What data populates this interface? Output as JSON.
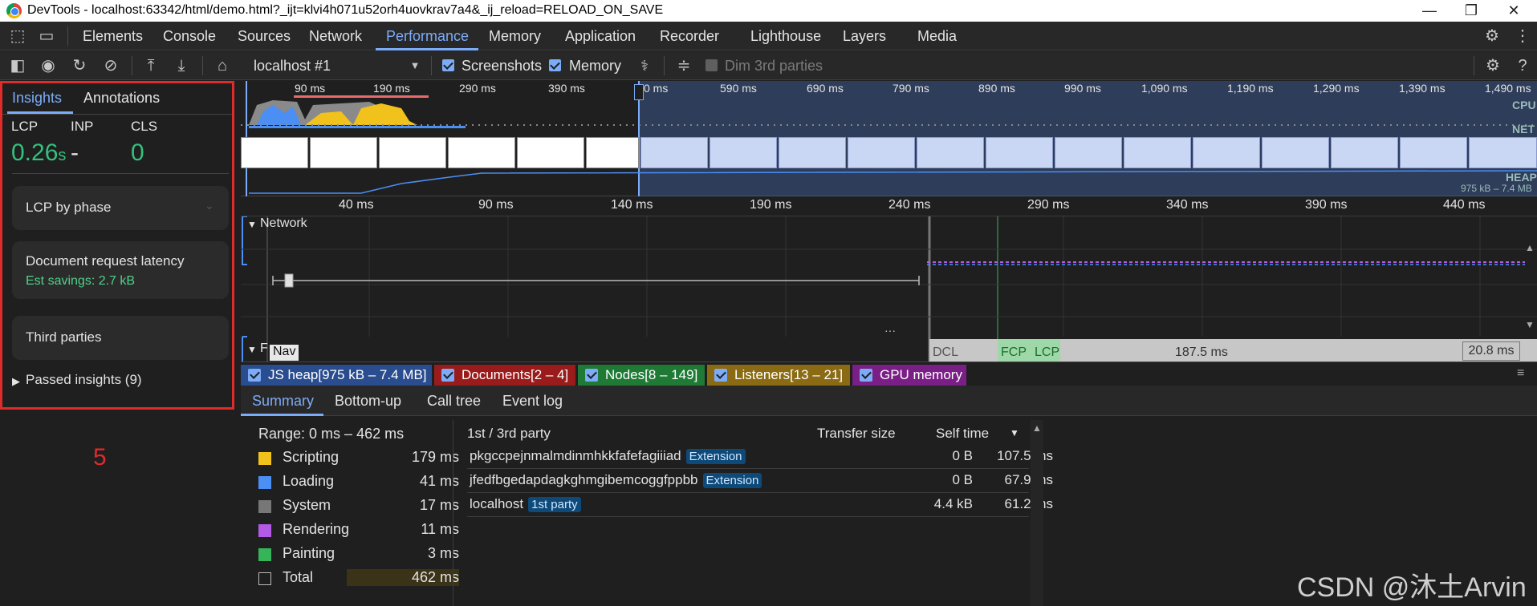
{
  "window": {
    "title": "DevTools - localhost:63342/html/demo.html?_ijt=klvi4h071u52orh4uovkrav7a4&_ij_reload=RELOAD_ON_SAVE",
    "minimize": "—",
    "maximize": "❐",
    "close": "✕"
  },
  "tabs": [
    "Elements",
    "Console",
    "Sources",
    "Network",
    "Performance",
    "Memory",
    "Application",
    "Recorder",
    "Lighthouse",
    "Layers",
    "Media"
  ],
  "active_tab": "Performance",
  "toolbar": {
    "target": "localhost #1",
    "screenshots": "Screenshots",
    "memory": "Memory",
    "dim_3rd": "Dim 3rd parties"
  },
  "sidebar": {
    "tab_insights": "Insights",
    "tab_annotations": "Annotations",
    "lcp_label": "LCP",
    "inp_label": "INP",
    "cls_label": "CLS",
    "lcp_value": "0.26",
    "lcp_unit": "s",
    "inp_value": "-",
    "cls_value": "0",
    "card1": "LCP by phase",
    "card2_title": "Document request latency",
    "card2_sub": "Est savings: 2.7 kB",
    "card3": "Third parties",
    "passed": "Passed insights (9)"
  },
  "annotation_number": "5",
  "overview": {
    "labels": [
      "90 ms",
      "190 ms",
      "290 ms",
      "390 ms",
      "0 ms",
      "590 ms",
      "690 ms",
      "790 ms",
      "890 ms",
      "990 ms",
      "1,090 ms",
      "1,190 ms",
      "1,290 ms",
      "1,390 ms",
      "1,490 ms"
    ],
    "cpu": "CPU",
    "net": "NET",
    "heap": "HEAP",
    "heap_range": "975 kB – 7.4 MB"
  },
  "timeline": {
    "labels": [
      "40 ms",
      "90 ms",
      "140 ms",
      "190 ms",
      "240 ms",
      "290 ms",
      "340 ms",
      "390 ms",
      "440 ms"
    ],
    "network": "Network",
    "frames_prefix": "F",
    "nav": "Nav",
    "dcl": "DCL",
    "fcp": "FCP",
    "lcp": "LCP",
    "dur1": "187.5 ms",
    "dur2": "20.8 ms"
  },
  "memory_counters": [
    {
      "label": "JS heap[975 kB – 7.4 MB]",
      "color": "#2a4d8f"
    },
    {
      "label": "Documents[2 – 4]",
      "color": "#9a1b1b"
    },
    {
      "label": "Nodes[8 – 149]",
      "color": "#1e7a35"
    },
    {
      "label": "Listeners[13 – 21]",
      "color": "#8a6a12"
    },
    {
      "label": "GPU memory",
      "color": "#7a1f86"
    }
  ],
  "bottom_tabs": [
    "Summary",
    "Bottom-up",
    "Call tree",
    "Event log"
  ],
  "summary": {
    "range": "Range: 0 ms – 462 ms",
    "categories": [
      {
        "name": "Scripting",
        "value": "179 ms",
        "color": "#f1c21b"
      },
      {
        "name": "Loading",
        "value": "41 ms",
        "color": "#4b8ff5"
      },
      {
        "name": "System",
        "value": "17 ms",
        "color": "#777777"
      },
      {
        "name": "Rendering",
        "value": "11 ms",
        "color": "#b35ae6"
      },
      {
        "name": "Painting",
        "value": "3 ms",
        "color": "#35b45a"
      },
      {
        "name": "Total",
        "value": "462 ms",
        "color": "#1f1f1f"
      }
    ]
  },
  "party_table": {
    "headers": [
      "1st / 3rd party",
      "Transfer size",
      "Self time"
    ],
    "rows": [
      {
        "name": "pkgccpejnmalmdinmhkkfafefagiiiad",
        "badge": "Extension",
        "size": "0 B",
        "time": "107.5 ms"
      },
      {
        "name": "jfedfbgedapdagkghmgibemcoggfppbb",
        "badge": "Extension",
        "size": "0 B",
        "time": "67.9 ms"
      },
      {
        "name": "localhost",
        "badge": "1st party",
        "size": "4.4 kB",
        "time": "61.2 ms"
      }
    ]
  },
  "watermark": "CSDN @沐土Arvin"
}
